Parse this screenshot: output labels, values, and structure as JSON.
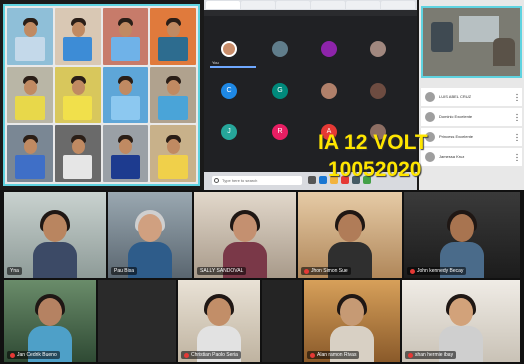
{
  "overlay": {
    "line1": "IA 12 VOLT",
    "line2": "10052020"
  },
  "meet": {
    "you_label": "You",
    "search_placeholder": "Type here to search",
    "tiles": [
      "C",
      "G",
      "",
      "",
      "J",
      "R",
      "A",
      "",
      "J",
      "",
      "",
      ""
    ]
  },
  "side_panel": {
    "items": [
      {
        "label": "LUIS ABEL CRUZ"
      },
      {
        "label": "Dominic Excelente"
      },
      {
        "label": "Princess Excelente"
      },
      {
        "label": "Jamessa Kruz"
      }
    ]
  },
  "gallery": {
    "names": [
      "Yna",
      "Pau Bisa",
      "SALLY SANDOVAL",
      "Jhon Simon Sue",
      "John kennedy Becay",
      "",
      "Jan Cedrik Bueno",
      "",
      "Christian Paolo Seria",
      "Alan ramon Rivas",
      "shan hermie ibay",
      ""
    ]
  },
  "colors": {
    "accent_border": "#5fd3e0",
    "overlay_text": "#ffe600",
    "meet_bg": "#202124",
    "mic_off": "#e53935"
  }
}
